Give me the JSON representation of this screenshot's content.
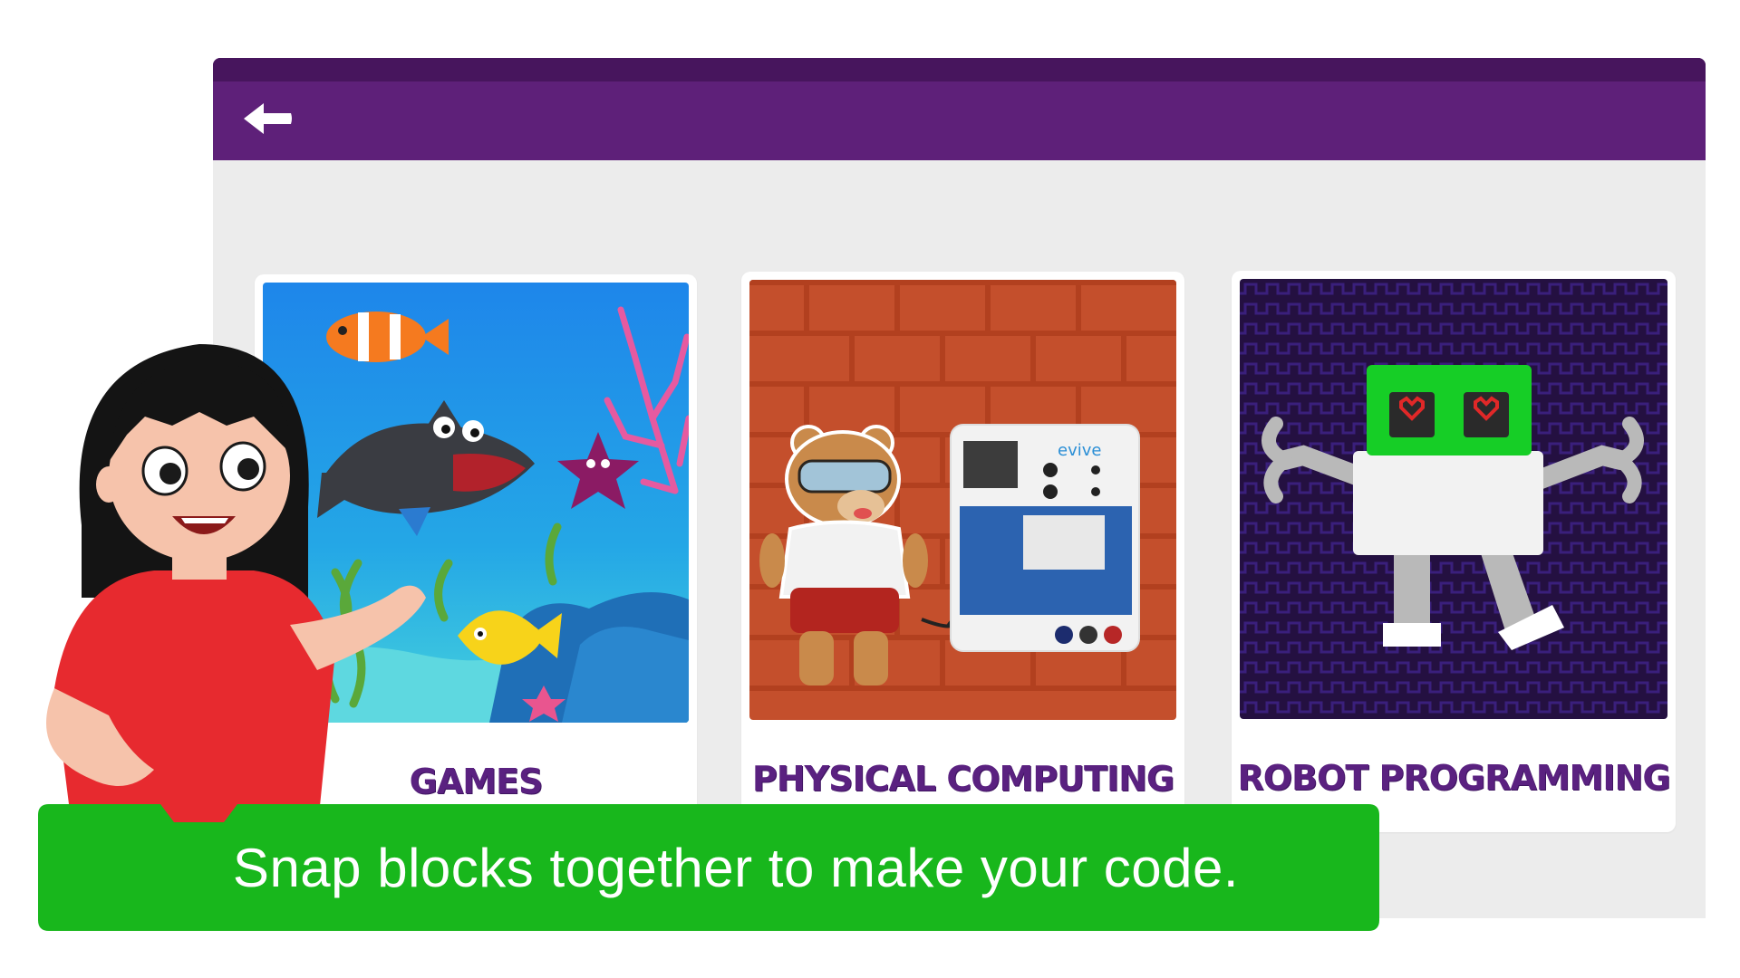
{
  "app": {
    "header": {
      "back_icon": "back-arrow-icon"
    },
    "colors": {
      "header": "#5e2079",
      "header_top": "#47155d",
      "content_bg": "#ececec",
      "card_label": "#5a2180",
      "banner": "#18b71c"
    }
  },
  "cards": [
    {
      "label": "GAMES",
      "illustration": "underwater-game-scene"
    },
    {
      "label": "PHYSICAL COMPUTING",
      "illustration": "bear-with-evive-board"
    },
    {
      "label": "ROBOT PROGRAMMING",
      "illustration": "robot-illustration"
    }
  ],
  "board": {
    "brand": "evive"
  },
  "banner": {
    "text": "Snap blocks together to make your code."
  }
}
